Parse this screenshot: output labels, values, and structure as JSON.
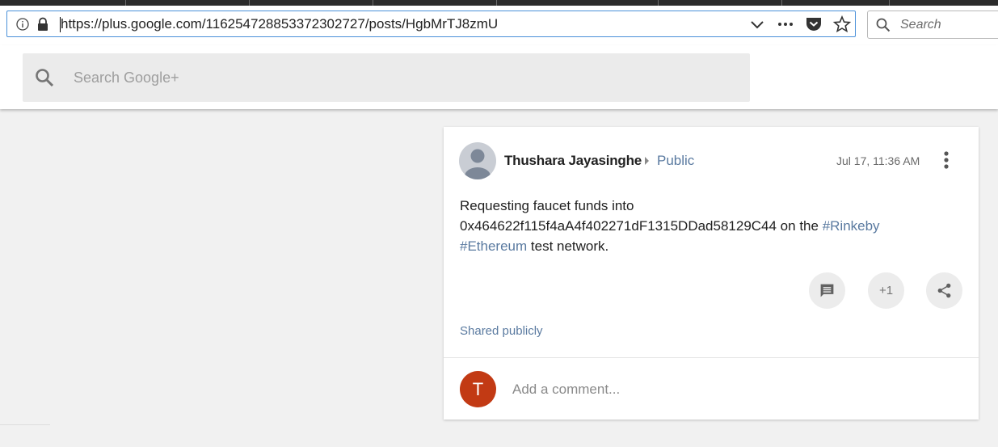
{
  "browser": {
    "url": "https://plus.google.com/116254728853372302727/posts/HgbMrTJ8zmU",
    "search_placeholder": "Search"
  },
  "gplus": {
    "search_placeholder": "Search Google+"
  },
  "post": {
    "author": "Thushara Jayasinghe",
    "visibility": "Public",
    "timestamp": "Jul 17, 11:36 AM",
    "text_line1": "Requesting faucet funds into",
    "text_line2_prefix": "0x464622f115f4aA4f402271dF1315DDad58129C44 on the ",
    "hashtag1": "#Rinkeby",
    "hashtag2": "#Ethereum",
    "text_suffix": " test network.",
    "plus_one_label": "+1",
    "shared_label": "Shared publicly"
  },
  "comment": {
    "avatar_letter": "T",
    "placeholder": "Add a comment..."
  }
}
